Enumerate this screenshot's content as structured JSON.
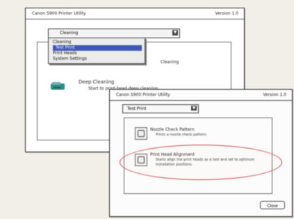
{
  "back_window": {
    "title": "Canon S900 Printer Utility",
    "version": "Version 1.0",
    "dropdown_selected": "Cleaning",
    "menu": {
      "items": [
        {
          "label": "Cleaning",
          "selected": false
        },
        {
          "label": "Test Print",
          "selected": true
        },
        {
          "label": "Print Heads",
          "selected": false
        },
        {
          "label": "System Settings",
          "selected": false
        }
      ]
    },
    "partial_item_text": "Cleaning",
    "deep_cleaning": {
      "title": "Deep Cleaning",
      "description": "Start to print-head deep cleaning."
    }
  },
  "front_window": {
    "title": "Canon S900 Printer Utility",
    "version": "Version 1.0",
    "dropdown_selected": "Test Print",
    "items": [
      {
        "title": "Nozzle Check Pattern",
        "description": "Prints a nozzle check pattern."
      },
      {
        "title": "Print Head Alignment",
        "description": "Starts align the print heads as a test and set to optimum installation positions."
      }
    ],
    "close_label": "Close"
  },
  "colors": {
    "highlight": "#3d58b5",
    "annotation_oval": "#d83a3a",
    "teal_icon": "#2d8c85"
  },
  "icons": {
    "dropdown": "chevron-down-icon",
    "deep_cleaning": "teal-printer-icon",
    "nozzle": "nozzle-check-icon",
    "alignment": "alignment-icon"
  }
}
